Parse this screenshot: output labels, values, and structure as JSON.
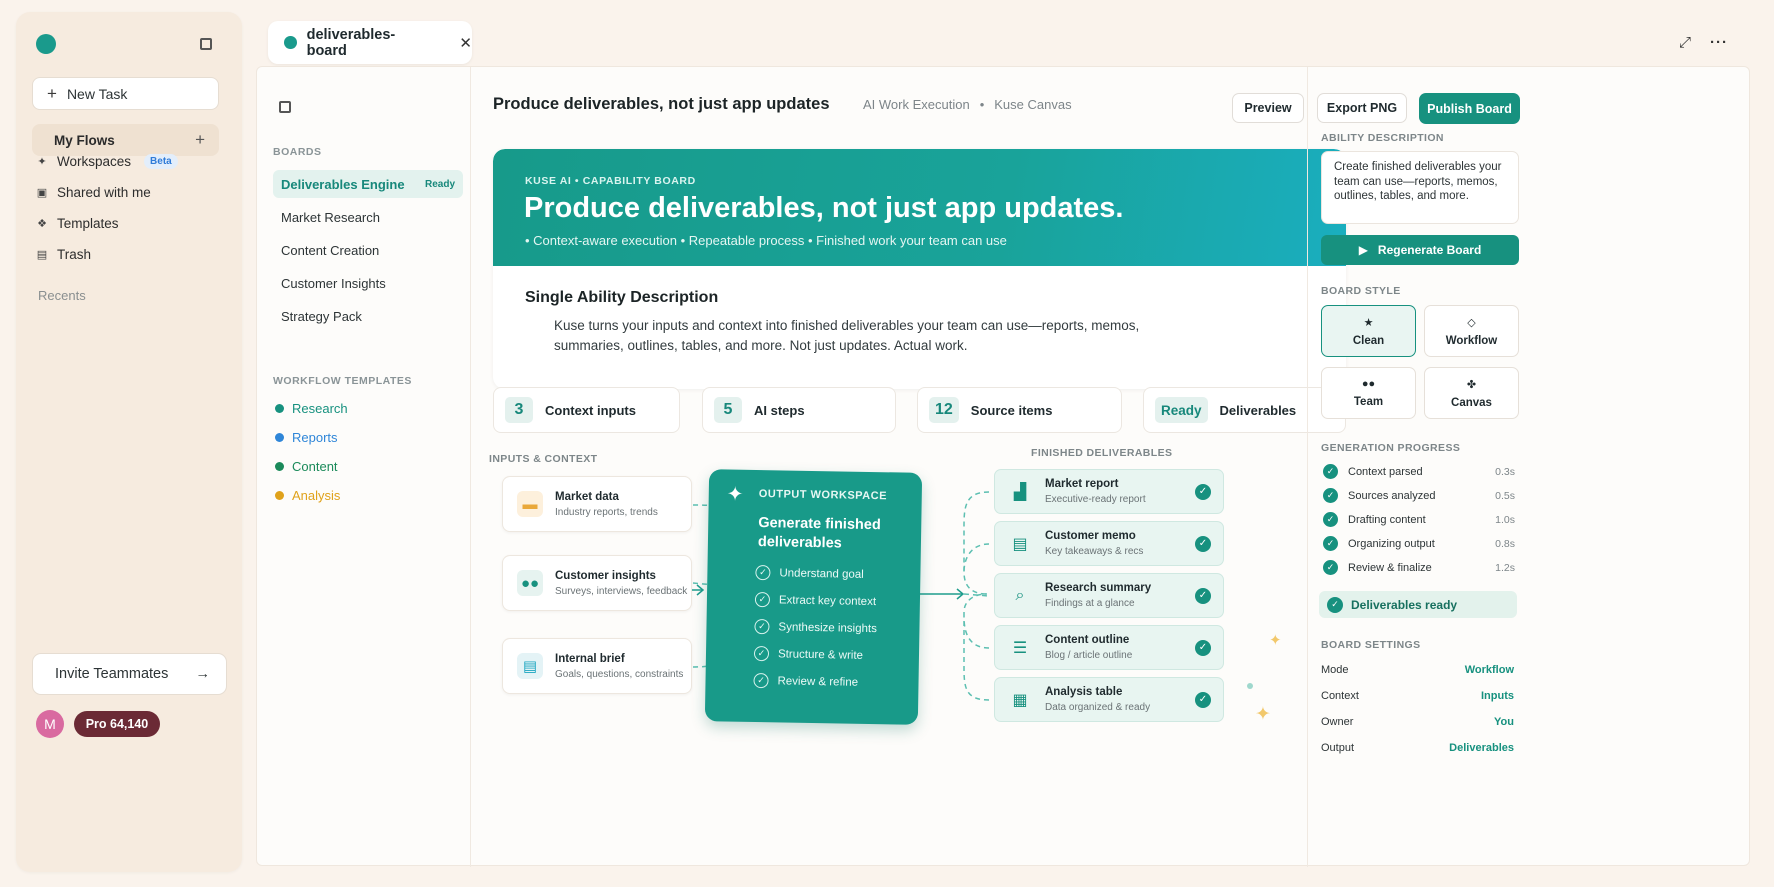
{
  "sidebar": {
    "new_task": "New Task",
    "my_flows": "My Flows",
    "items": [
      {
        "label": "Workspaces",
        "badge": "Beta",
        "icon": "sparkle-icon"
      },
      {
        "label": "Shared with me",
        "icon": "shared-icon"
      },
      {
        "label": "Templates",
        "icon": "templates-icon"
      },
      {
        "label": "Trash",
        "icon": "trash-icon"
      }
    ],
    "recents": "Recents",
    "invite": "Invite Teammates",
    "avatar_initial": "M",
    "plan": "Pro 64,140"
  },
  "tab": {
    "title": "deliverables-board"
  },
  "boards": {
    "heading": "BOARDS",
    "items": [
      {
        "label": "Deliverables Engine",
        "status": "Ready"
      },
      {
        "label": "Market Research"
      },
      {
        "label": "Content Creation"
      },
      {
        "label": "Customer Insights"
      },
      {
        "label": "Strategy Pack"
      }
    ],
    "templates_heading": "WORKFLOW TEMPLATES",
    "templates": [
      {
        "label": "Research",
        "color": "#17917f"
      },
      {
        "label": "Reports",
        "color": "#2f86d8"
      },
      {
        "label": "Content",
        "color": "#1b8a5a"
      },
      {
        "label": "Analysis",
        "color": "#e0a21b"
      }
    ]
  },
  "header": {
    "title": "Produce deliverables, not just app updates",
    "crumbs": [
      "AI Work Execution",
      "•",
      "Kuse Canvas"
    ],
    "preview": "Preview",
    "export": "Export PNG",
    "publish": "Publish Board"
  },
  "hero": {
    "kicker": "KUSE AI • CAPABILITY BOARD",
    "title": "Produce deliverables, not just app updates.",
    "bullets": "• Context-aware execution  •  Repeatable process  •  Finished work your team can use",
    "desc_title": "Single Ability Description",
    "desc_body": "Kuse turns your inputs and context into finished deliverables your team can use—reports, memos, summaries, outlines, tables, and more. Not just updates. Actual work."
  },
  "stats": [
    {
      "value": "3",
      "label": "Context inputs"
    },
    {
      "value": "5",
      "label": "AI steps"
    },
    {
      "value": "12",
      "label": "Source items"
    },
    {
      "value": "Ready",
      "label": "Deliverables"
    }
  ],
  "diagram": {
    "inputs_label": "INPUTS & CONTEXT",
    "inputs": [
      {
        "title": "Market data",
        "sub": "Industry reports, trends",
        "icon": "folder-icon"
      },
      {
        "title": "Customer insights",
        "sub": "Surveys, interviews, feedback",
        "icon": "people-icon"
      },
      {
        "title": "Internal brief",
        "sub": "Goals, questions, constraints",
        "icon": "document-icon"
      }
    ],
    "workspace": {
      "kicker": "OUTPUT WORKSPACE",
      "title": "Generate finished deliverables",
      "steps": [
        "Understand goal",
        "Extract key context",
        "Synthesize insights",
        "Structure & write",
        "Review & refine"
      ]
    },
    "outputs_label": "FINISHED DELIVERABLES",
    "outputs": [
      {
        "title": "Market report",
        "sub": "Executive-ready report",
        "icon": "bar-chart-icon"
      },
      {
        "title": "Customer memo",
        "sub": "Key takeaways & recs",
        "icon": "memo-icon"
      },
      {
        "title": "Research summary",
        "sub": "Findings at a glance",
        "icon": "magnifier-icon"
      },
      {
        "title": "Content outline",
        "sub": "Blog / article outline",
        "icon": "list-icon"
      },
      {
        "title": "Analysis table",
        "sub": "Data organized & ready",
        "icon": "table-icon"
      }
    ]
  },
  "panel": {
    "ability_label": "ABILITY DESCRIPTION",
    "ability_text": "Create finished deliverables your team can use—reports, memos, outlines, tables, and more.",
    "regen": "Regenerate Board",
    "style_label": "BOARD STYLE",
    "styles": [
      "Clean",
      "Workflow",
      "Team",
      "Canvas"
    ],
    "progress_label": "GENERATION PROGRESS",
    "progress": [
      {
        "label": "Context parsed",
        "time": "0.3s"
      },
      {
        "label": "Sources analyzed",
        "time": "0.5s"
      },
      {
        "label": "Drafting content",
        "time": "1.0s"
      },
      {
        "label": "Organizing output",
        "time": "0.8s"
      },
      {
        "label": "Review & finalize",
        "time": "1.2s"
      }
    ],
    "ready": "Deliverables ready",
    "settings_label": "BOARD SETTINGS",
    "settings": [
      {
        "key": "Mode",
        "value": "Workflow"
      },
      {
        "key": "Context",
        "value": "Inputs"
      },
      {
        "key": "Owner",
        "value": "You"
      },
      {
        "key": "Output",
        "value": "Deliverables"
      }
    ]
  },
  "colors": {
    "accent": "#17917f",
    "background": "#faf3ec"
  }
}
